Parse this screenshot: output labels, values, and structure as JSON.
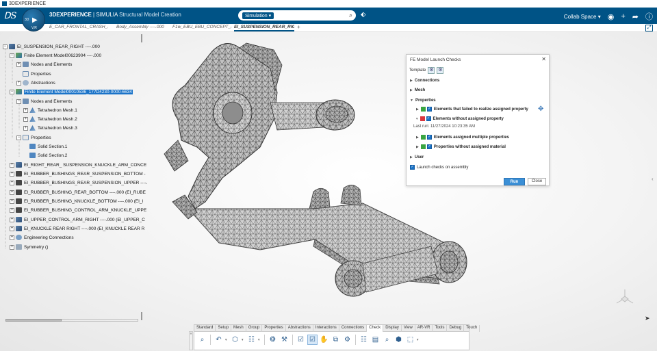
{
  "window": {
    "title": "3DEXPERIENCE"
  },
  "topbar": {
    "brand_bold": "3DEXPERIENCE",
    "brand_sep": " | ",
    "brand_company": "SIMULIA",
    "app_name": "Structural Model Creation",
    "search_context": "Simulation ▾",
    "search_placeholder": "",
    "collab_space": "Collab Space ▾",
    "accent_color": "#005386"
  },
  "compass": {
    "left_label": "3D",
    "bottom_label": "V,R"
  },
  "doc_tabs": [
    {
      "label": "E_CAR_FRONTAL_CRASH_Si"
    },
    {
      "label": "Body_Assembly ----.000"
    },
    {
      "label": "F1w_EBU_EBU_CONCEPT_Fr"
    },
    {
      "label": "EI_SUSPENSION_REAR_RIG"
    }
  ],
  "tree": {
    "nodes": [
      {
        "label": "EI_SUSPENSION_REAR_RIGHT ----.000",
        "expander": "−"
      },
      {
        "label": "Finite Element Model00623904 ----.000",
        "expander": "−"
      },
      {
        "label": "Nodes and Elements",
        "expander": "+"
      },
      {
        "label": "Properties",
        "expander": ""
      },
      {
        "label": "Abstractions",
        "expander": "+"
      },
      {
        "label": "Finite Element Model00010536_177D4230-0000-6634",
        "expander": "−"
      },
      {
        "label": "Nodes and Elements",
        "expander": "−"
      },
      {
        "label": "Tetrahedron Mesh.1",
        "expander": "+"
      },
      {
        "label": "Tetrahedron Mesh.2",
        "expander": "+"
      },
      {
        "label": "Tetrahedron Mesh.3",
        "expander": "+"
      },
      {
        "label": "Properties",
        "expander": "−"
      },
      {
        "label": "Solid Section.1",
        "expander": ""
      },
      {
        "label": "Solid Section.2",
        "expander": ""
      },
      {
        "label": "EI_RIGHT_REAR_ SUSPENSION_KNUCKLE_ARM_CONCE",
        "expander": "+"
      },
      {
        "label": "EI_RUBBER_BUSHINGS_REAR_SUSPENSION_BOTTOM -",
        "expander": "+"
      },
      {
        "label": "EI_RUBBER_BUSHINGS_REAR_SUSPENSION_UPPER ----.",
        "expander": "+"
      },
      {
        "label": "EI_RUBBER_BUSHING_REAR_BOTTOM ----.000 (EI_RUBE",
        "expander": "+"
      },
      {
        "label": "EI_RUBBER_BUSHING_KNUCKLE_BOTTOM ----.000 (EI_I",
        "expander": "+"
      },
      {
        "label": "EI_RUBBER_BUSHING_CONTROL_ARM_KNUCKLE_UPPE",
        "expander": "+"
      },
      {
        "label": "EI_UPPER_CONTROL_ARM_RIGHT ----.000 (EI_UPPER_C",
        "expander": "+"
      },
      {
        "label": "EI_KNUCKLE REAR RIGHT ----.000 (EI_KNUCKLE REAR R",
        "expander": "+"
      },
      {
        "label": "Engineering Connections",
        "expander": "+"
      },
      {
        "label": "Symmetry ()",
        "expander": "+"
      }
    ]
  },
  "checks_panel": {
    "title": "FE Model Launch Checks",
    "template_label": "Template",
    "sections": {
      "connections": "Connections",
      "mesh": "Mesh",
      "properties": "Properties",
      "user": "User"
    },
    "checks": [
      {
        "label": "Elements that failed to realize assigned property",
        "status": "pass"
      },
      {
        "label": "Elements without assigned property",
        "status": "fail"
      },
      {
        "label": "Elements assigned multiple properties",
        "status": "pass"
      },
      {
        "label": "Properties without assigned material",
        "status": "pass"
      }
    ],
    "last_run": "Last run: 11/27/2024 10:23:35 AM",
    "launch_on_assembly": "Launch checks on assembly",
    "run_label": "Run",
    "close_label": "Close",
    "status_colors": {
      "pass": "#3aa541",
      "fail": "#d9363e"
    }
  },
  "action_bar": {
    "tabs": [
      "Standard",
      "Setup",
      "Mesh",
      "Group",
      "Properties",
      "Abstractions",
      "Interactions",
      "Connections",
      "Check",
      "Display",
      "View",
      "AR-VR",
      "Tools",
      "Debug",
      "Touch"
    ],
    "active_tab": "Check",
    "tools": [
      {
        "icon": "zoom-icon",
        "glyph": "⌕"
      },
      {
        "icon": "undo-icon",
        "glyph": "↶"
      },
      {
        "icon": "part-icon",
        "glyph": "⬡"
      },
      {
        "icon": "table-icon",
        "glyph": "☷"
      },
      {
        "icon": "mesh-check-icon",
        "glyph": "❂"
      },
      {
        "icon": "ruler-icon",
        "glyph": "⚒"
      },
      {
        "icon": "check-list-icon",
        "glyph": "☑"
      },
      {
        "icon": "check-active-icon",
        "glyph": "☑"
      },
      {
        "icon": "hand-icon",
        "glyph": "✋"
      },
      {
        "icon": "compare-icon",
        "glyph": "⧉"
      },
      {
        "icon": "analyze-icon",
        "glyph": "⚙"
      },
      {
        "icon": "hierarchy-icon",
        "glyph": "☷"
      },
      {
        "icon": "layers-icon",
        "glyph": "▤"
      },
      {
        "icon": "search-part-icon",
        "glyph": "⌕"
      },
      {
        "icon": "filter-icon",
        "glyph": "⬢"
      },
      {
        "icon": "export-icon",
        "glyph": "⬚"
      }
    ]
  }
}
